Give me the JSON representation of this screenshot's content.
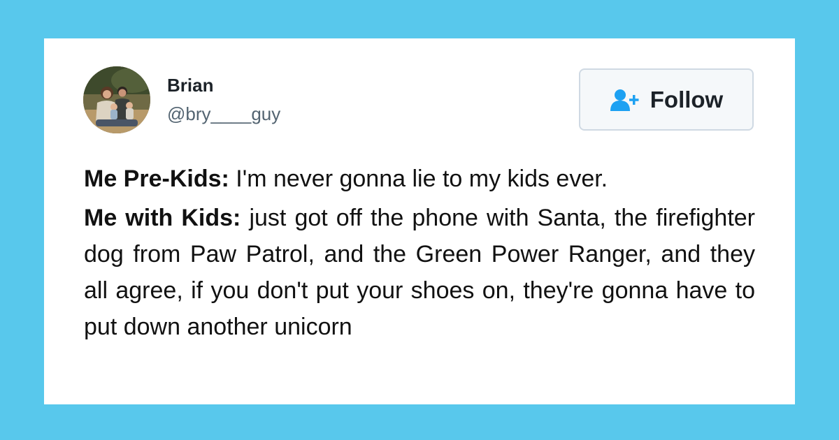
{
  "tweet": {
    "author": {
      "name": "Brian",
      "handle": "@bry____guy",
      "avatar_icon": "family-photo-avatar"
    },
    "follow_button": {
      "label": "Follow",
      "icon": "add-user-icon",
      "icon_color": "#1da1f2"
    },
    "body": {
      "line1_label": "Me Pre-Kids:",
      "line1_text": "I'm never gonna lie to my kids ever.",
      "line2_label": "Me with Kids:",
      "line2_text": "just got off the phone with Santa, the firefighter dog from Paw Patrol, and the Green Power Ranger, and they all agree, if you don't put your shoes on, they're gonna have to put down another unicorn"
    }
  },
  "colors": {
    "background": "#58c8ec",
    "card": "#ffffff",
    "handle": "#536471",
    "text": "#111111"
  }
}
